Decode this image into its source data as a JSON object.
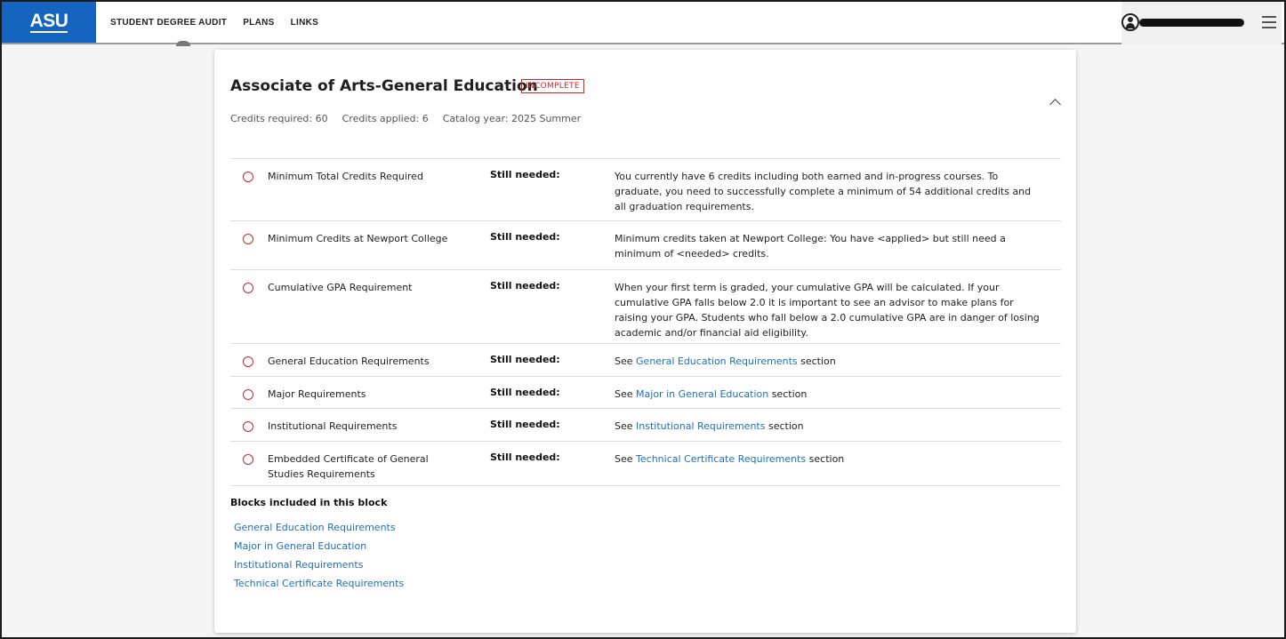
{
  "header": {
    "logo_text": "ASU",
    "nav": [
      {
        "label": "STUDENT DEGREE AUDIT",
        "active": true
      },
      {
        "label": "PLANS",
        "active": false
      },
      {
        "label": "LINKS",
        "active": false
      }
    ],
    "user_icon": "account-circle-icon",
    "menu_icon": "hamburger-menu-icon"
  },
  "card": {
    "title": "Associate of Arts-General Education",
    "status_badge": "INCOMPLETE",
    "meta": {
      "credits_required": "Credits required: 60",
      "credits_applied": "Credits applied: 6",
      "catalog_year": "Catalog year: 2025 Summer"
    },
    "collapse_icon": "chevron-up-icon",
    "requirements": [
      {
        "name": "Minimum Total Credits Required",
        "status": "Still needed:",
        "description": "You currently have 6 credits including both earned and in-progress courses. To graduate, you need to successfully complete a minimum of 54 additional credits and all graduation requirements."
      },
      {
        "name": "Minimum Credits at Newport College",
        "status": "Still needed:",
        "description": "Minimum credits taken at Newport College: You have <applied> but still need a minimum of <needed> credits."
      },
      {
        "name": "Cumulative GPA Requirement",
        "status": "Still needed:",
        "description": "When your first term is graded, your cumulative GPA will be calculated. If your cumulative GPA falls below 2.0 it is important to see an advisor to make plans for raising your GPA. Students who fall below a 2.0 cumulative GPA are in danger of losing academic and/or financial aid eligibility."
      },
      {
        "name": "General Education Requirements",
        "status": "Still needed:",
        "see": "See",
        "link": "General Education Requirements",
        "suffix": "section"
      },
      {
        "name": "Major Requirements",
        "status": "Still needed:",
        "see": "See",
        "link": "Major in General Education",
        "suffix": "section"
      },
      {
        "name": "Institutional Requirements",
        "status": "Still needed:",
        "see": "See",
        "link": "Institutional Requirements",
        "suffix": "section"
      },
      {
        "name": "Embedded Certificate of General Studies Requirements",
        "status": "Still needed:",
        "see": "See",
        "link": "Technical Certificate Requirements",
        "suffix": "section"
      }
    ],
    "blocks_title": "Blocks included in this block",
    "blocks": [
      "General Education Requirements",
      "Major in General Education",
      "Institutional Requirements",
      "Technical Certificate Requirements"
    ]
  },
  "colors": {
    "brand_blue": "#1565c0",
    "incomplete_red": "#c62828",
    "link_blue": "#1e6fb8"
  }
}
